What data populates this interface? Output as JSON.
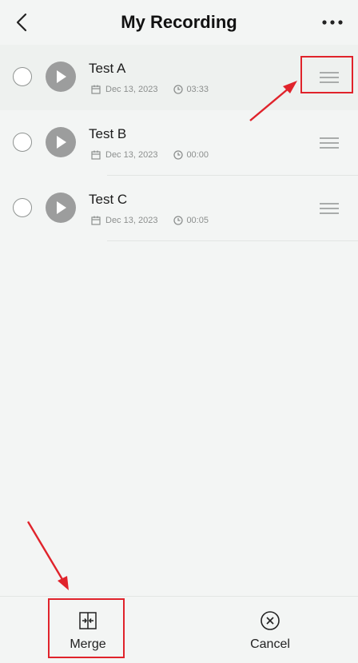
{
  "header": {
    "title": "My Recording"
  },
  "recordings": [
    {
      "title": "Test A",
      "date": "Dec 13, 2023",
      "duration": "03:33"
    },
    {
      "title": "Test B",
      "date": "Dec 13, 2023",
      "duration": "00:00"
    },
    {
      "title": "Test C",
      "date": "Dec 13, 2023",
      "duration": "00:05"
    }
  ],
  "bottom_bar": {
    "merge_label": "Merge",
    "cancel_label": "Cancel"
  },
  "colors": {
    "background": "#f3f5f4",
    "annotation_red": "#e0232b",
    "play_button": "#9c9d9d"
  }
}
